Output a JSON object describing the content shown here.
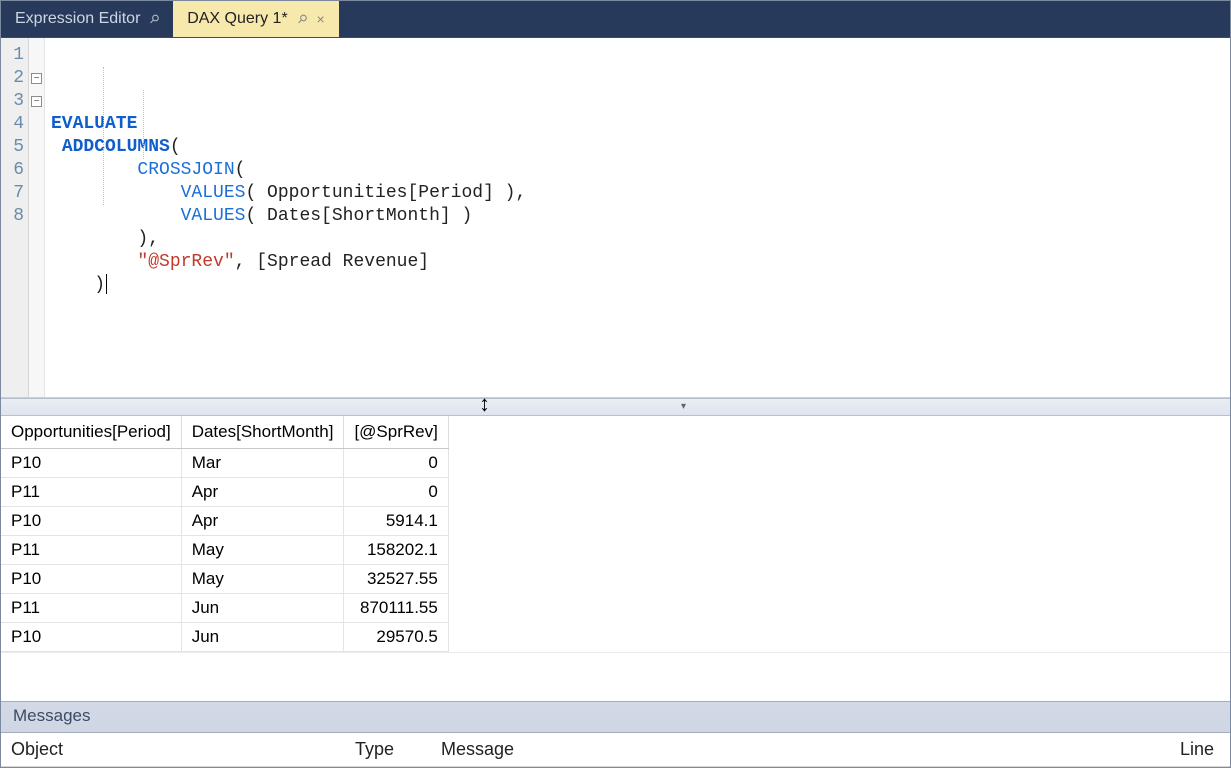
{
  "tabs": [
    {
      "label": "Expression Editor",
      "active": false
    },
    {
      "label": "DAX Query 1*",
      "active": true
    }
  ],
  "code": {
    "lines": [
      "1",
      "2",
      "3",
      "4",
      "5",
      "6",
      "7",
      "8"
    ],
    "l1_evaluate": "EVALUATE",
    "l2_addcolumns": "ADDCOLUMNS",
    "l2_paren": "(",
    "l3_crossjoin": "CROSSJOIN",
    "l3_paren": "(",
    "l4_values": "VALUES",
    "l4_rest": "( Opportunities[Period] ),",
    "l5_values": "VALUES",
    "l5_rest": "( Dates[ShortMonth] )",
    "l6": "),",
    "l7_str": "\"@SprRev\"",
    "l7_rest": ", [Spread Revenue]",
    "l8": ")"
  },
  "results": {
    "headers": [
      "Opportunities[Period]",
      "Dates[ShortMonth]",
      "[@SprRev]"
    ],
    "rows": [
      {
        "period": "P10",
        "month": "Mar",
        "val": "0"
      },
      {
        "period": "P11",
        "month": "Apr",
        "val": "0"
      },
      {
        "period": "P10",
        "month": "Apr",
        "val": "5914.1"
      },
      {
        "period": "P11",
        "month": "May",
        "val": "158202.1"
      },
      {
        "period": "P10",
        "month": "May",
        "val": "32527.55"
      },
      {
        "period": "P11",
        "month": "Jun",
        "val": "870111.55"
      },
      {
        "period": "P10",
        "month": "Jun",
        "val": "29570.5"
      }
    ]
  },
  "messages": {
    "title": "Messages",
    "cols": {
      "object": "Object",
      "type": "Type",
      "message": "Message",
      "line": "Line"
    }
  }
}
